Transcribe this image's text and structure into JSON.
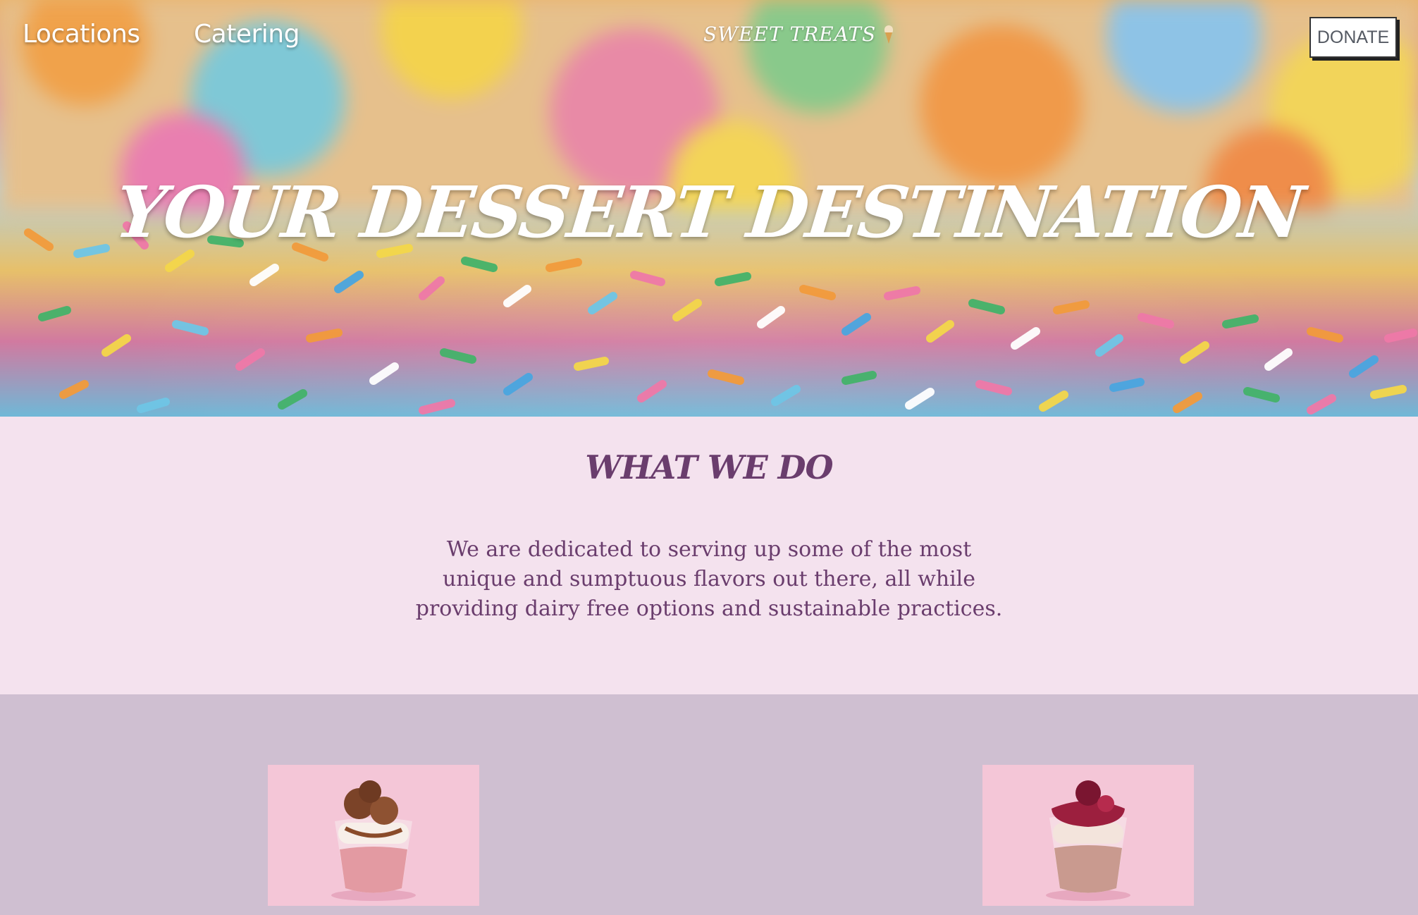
{
  "nav": {
    "links": [
      "Locations",
      "Catering"
    ],
    "brand": "SWEET TREATS",
    "brand_icon": "ice-cream-cone-icon",
    "donate_label": "DONATE"
  },
  "hero": {
    "title": "YOUR DESSERT DESTINATION",
    "background": "rainbow-sprinkles-photo"
  },
  "about": {
    "title": "WHAT WE DO",
    "body": "We are dedicated to serving up some of the most unique and sumptuous flavors out there, all while providing dairy free options and sustainable practices."
  },
  "products": [
    {
      "image": "chocolate-parfait-photo"
    },
    {
      "image": "strawberry-parfait-photo"
    }
  ],
  "colors": {
    "accent_text": "#6a3d6d",
    "about_bg": "#f4e2ee",
    "products_bg": "#cfbfd1",
    "product_bg": "#f4c6d7"
  }
}
